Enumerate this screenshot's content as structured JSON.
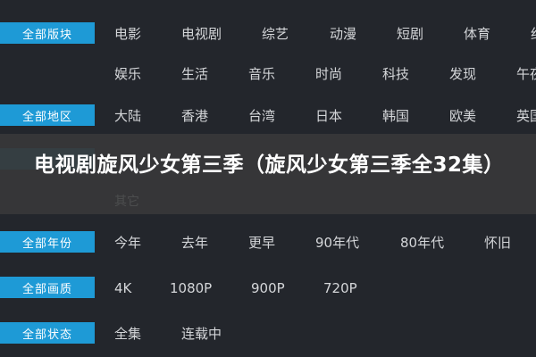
{
  "filters": {
    "type": {
      "label": "全部版块",
      "items": [
        "电影",
        "电视剧",
        "综艺",
        "动漫",
        "短剧",
        "体育",
        "纪"
      ],
      "items2": [
        "娱乐",
        "生活",
        "音乐",
        "时尚",
        "科技",
        "发现",
        "午夜"
      ]
    },
    "region": {
      "label": "全部地区",
      "items": [
        "大陆",
        "香港",
        "台湾",
        "日本",
        "韩国",
        "欧美",
        "英国"
      ],
      "items2": [
        "其它"
      ]
    },
    "year": {
      "label": "全部年份",
      "items": [
        "今年",
        "去年",
        "更早",
        "90年代",
        "80年代",
        "怀旧"
      ]
    },
    "quality": {
      "label": "全部画质",
      "items": [
        "4K",
        "1080P",
        "900P",
        "720P"
      ]
    },
    "status": {
      "label": "全部状态",
      "items": [
        "全集",
        "连载中"
      ]
    }
  },
  "overlay_title": "电视剧旋风少女第三季（旋风少女第三季全32集）",
  "colors": {
    "accent": "#1e9ad6",
    "background": "#23262c"
  }
}
